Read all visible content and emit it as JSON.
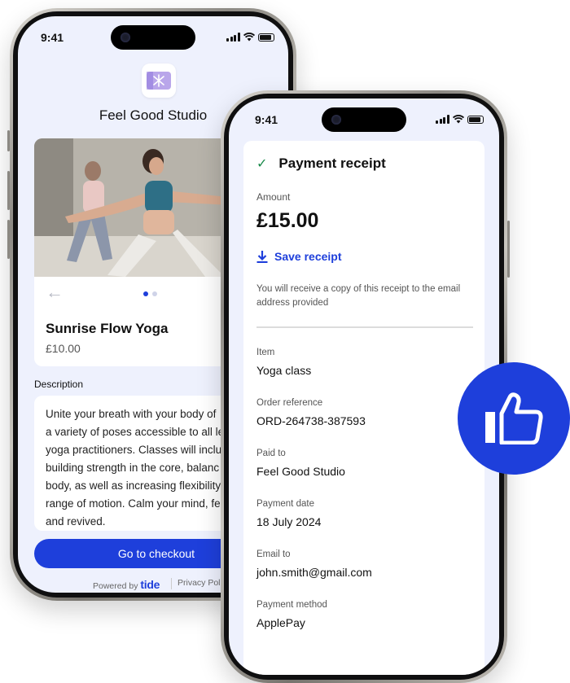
{
  "back_phone": {
    "status_time": "9:41",
    "studio_name": "Feel Good Studio",
    "carousel_page": 1,
    "carousel_pages": 2,
    "class_name": "Sunrise Flow Yoga",
    "class_price": "£10.00",
    "description_label": "Description",
    "description_lines": [
      "Unite your breath with your body of",
      "a variety of poses accessible to all le",
      "yoga practitioners. Classes will inclu",
      "building strength in the core, balanc",
      "body, as well as increasing flexibility",
      "range of motion. Calm your mind, fe",
      "and revived."
    ],
    "checkout_label": "Go to checkout",
    "powered_by_label": "Powered by",
    "powered_by_brand": "tide",
    "privacy_label": "Privacy Policy"
  },
  "front_phone": {
    "status_time": "9:41",
    "receipt_title": "Payment receipt",
    "amount_label": "Amount",
    "amount_value": "£15.00",
    "save_label": "Save receipt",
    "note": "You will receive a copy of this receipt to the email address provided",
    "fields": [
      {
        "label": "Item",
        "value": "Yoga class"
      },
      {
        "label": "Order reference",
        "value": "ORD-264738-387593"
      },
      {
        "label": "Paid to",
        "value": "Feel Good Studio"
      },
      {
        "label": "Payment date",
        "value": "18 July 2024"
      },
      {
        "label": "Email to",
        "value": "john.smith@gmail.com"
      },
      {
        "label": "Payment method",
        "value": "ApplePay"
      }
    ]
  },
  "colors": {
    "brand_blue": "#1e3fdb",
    "check_green": "#1a8a4a",
    "screen_bg": "#eef1fd",
    "logo_purple": "#b9a6ea"
  },
  "icons": [
    "back-arrow-icon",
    "check-icon",
    "download-icon",
    "thumbs-up-icon",
    "wifi-icon",
    "signal-icon",
    "battery-icon",
    "studio-logo-icon"
  ]
}
